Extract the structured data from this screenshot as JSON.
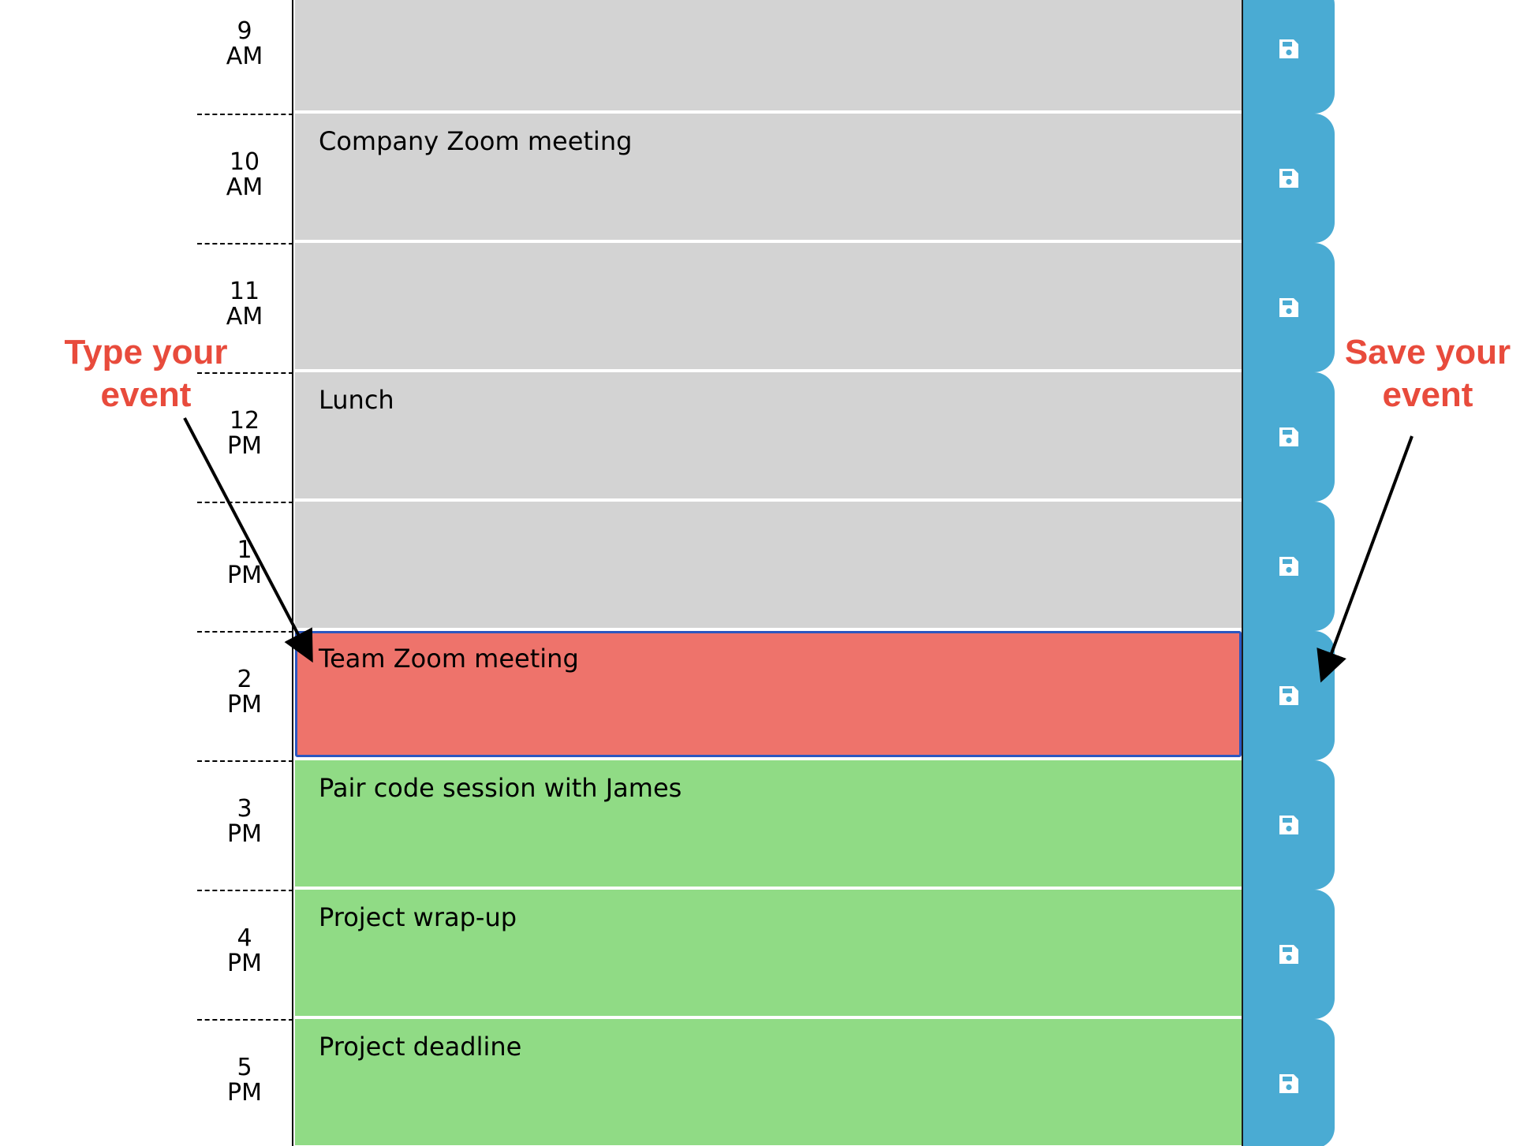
{
  "scheduler": {
    "rows": [
      {
        "hour": "9",
        "ampm": "AM",
        "event": "",
        "status": "past"
      },
      {
        "hour": "10",
        "ampm": "AM",
        "event": "Company Zoom meeting",
        "status": "past"
      },
      {
        "hour": "11",
        "ampm": "AM",
        "event": "",
        "status": "past"
      },
      {
        "hour": "12",
        "ampm": "PM",
        "event": "Lunch",
        "status": "past"
      },
      {
        "hour": "1",
        "ampm": "PM",
        "event": "",
        "status": "past"
      },
      {
        "hour": "2",
        "ampm": "PM",
        "event": "Team Zoom meeting",
        "status": "present"
      },
      {
        "hour": "3",
        "ampm": "PM",
        "event": "Pair code session with James",
        "status": "future"
      },
      {
        "hour": "4",
        "ampm": "PM",
        "event": "Project wrap-up",
        "status": "future"
      },
      {
        "hour": "5",
        "ampm": "PM",
        "event": "Project deadline",
        "status": "future"
      }
    ],
    "save_icon": "floppy-disk-icon"
  },
  "annotations": {
    "type_line1": "Type your",
    "type_line2": "event",
    "save_line1": "Save your",
    "save_line2": "event"
  },
  "colors": {
    "past": "#d3d3d3",
    "present": "#ee736b",
    "future": "#90db85",
    "save_button": "#4aabd3",
    "annotation": "#e84b3c"
  }
}
